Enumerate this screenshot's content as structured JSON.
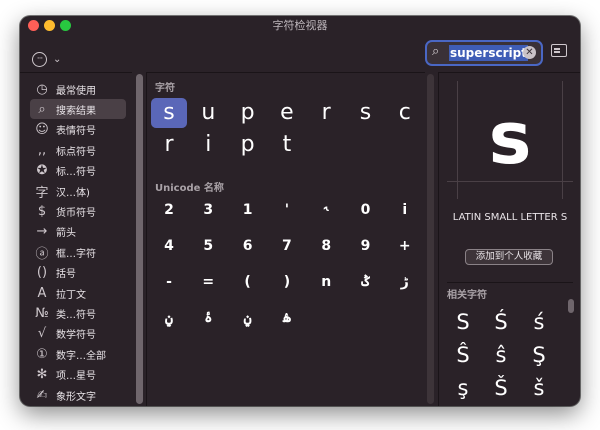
{
  "window": {
    "title": "字符检视器"
  },
  "toolbar": {
    "search_value": "superscript",
    "clear_glyph": "✕",
    "options_glyph": "···",
    "chevron_glyph": "⌄"
  },
  "sidebar": {
    "items": [
      {
        "icon": "clock-icon",
        "glyph": "◷",
        "label": "最常使用"
      },
      {
        "icon": "search-icon",
        "glyph": "⌕",
        "label": "搜索结果",
        "selected": true
      },
      {
        "icon": "smiley-icon",
        "glyph": "☺",
        "label": "表情符号"
      },
      {
        "icon": "punctuation-icon",
        "glyph": ",,",
        "label": "标点符号"
      },
      {
        "icon": "tag-icon",
        "glyph": "✪",
        "label": "标…符号"
      },
      {
        "icon": "han-icon",
        "glyph": "字",
        "label": "汉…体)"
      },
      {
        "icon": "dollar-icon",
        "glyph": "$",
        "label": "货币符号"
      },
      {
        "icon": "arrow-icon",
        "glyph": "→",
        "label": "箭头"
      },
      {
        "icon": "circled-a-icon",
        "glyph": "ⓐ",
        "label": "框…字符"
      },
      {
        "icon": "parentheses-icon",
        "glyph": "()",
        "label": "括号"
      },
      {
        "icon": "latin-a-icon",
        "glyph": "A",
        "label": "拉丁文"
      },
      {
        "icon": "numero-icon",
        "glyph": "№",
        "label": "类…符号"
      },
      {
        "icon": "sqrt-icon",
        "glyph": "√",
        "label": "数学符号"
      },
      {
        "icon": "circled-one-icon",
        "glyph": "①",
        "label": "数字…全部"
      },
      {
        "icon": "asterisk-icon",
        "glyph": "✻",
        "label": "项…星号"
      },
      {
        "icon": "pictograph-icon",
        "glyph": "✍",
        "label": "象形文字"
      }
    ]
  },
  "center": {
    "chars_heading": "字符",
    "chars": [
      "s",
      "u",
      "p",
      "e",
      "r",
      "s",
      "c",
      "r",
      "i",
      "p",
      "t"
    ],
    "unicode_heading": "Unicode 名称",
    "unicode_chars": [
      "2",
      "3",
      "1",
      "'",
      "˞",
      "0",
      "i",
      "4",
      "5",
      "6",
      "7",
      "8",
      "9",
      "+",
      "-",
      "=",
      "(",
      ")",
      "n",
      "ݣ",
      "ڑ",
      "ݧ",
      "ۂ",
      "ݧ",
      "ۿ"
    ]
  },
  "detail": {
    "char": "s",
    "name": "LATIN SMALL LETTER S",
    "fav_label": "添加到个人收藏",
    "related_heading": "相关字符",
    "related": [
      "S",
      "Ś",
      "ś",
      "Ŝ",
      "ŝ",
      "Ş",
      "ş",
      "Š",
      "š"
    ]
  },
  "colors": {
    "window_bg": "#2a2228",
    "selection": "#5a67b8",
    "search_border": "#4a67c4"
  }
}
